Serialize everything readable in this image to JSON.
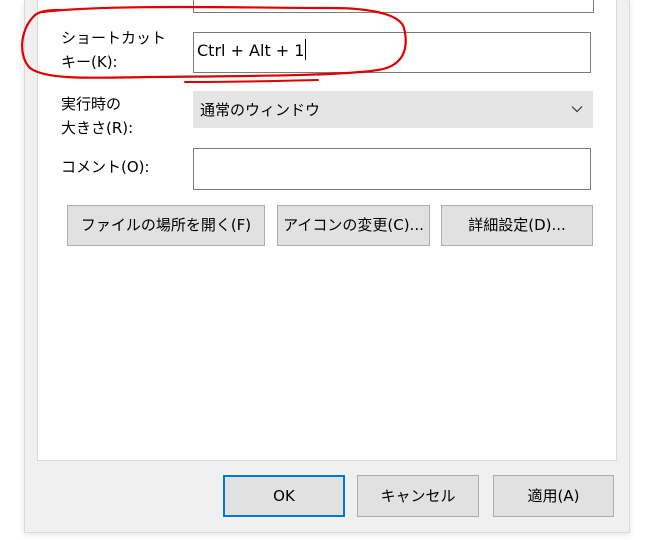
{
  "fields": {
    "shortcut_label": "ショートカット\nキー(K):",
    "shortcut_value": "Ctrl + Alt + 1",
    "run_label": "実行時の\n大きさ(R):",
    "run_value": "通常のウィンドウ",
    "comment_label": "コメント(O):",
    "comment_value": ""
  },
  "buttons": {
    "open_location": "ファイルの場所を開く(F)",
    "change_icon": "アイコンの変更(C)...",
    "advanced": "詳細設定(D)..."
  },
  "dialog_buttons": {
    "ok": "OK",
    "cancel": "キャンセル",
    "apply": "適用(A)"
  },
  "colors": {
    "dialog_bg": "#f0f0f0",
    "panel_bg": "#ffffff",
    "button_bg": "#e1e1e1",
    "default_button_border": "#0078d7",
    "annotation": "#e00000"
  },
  "icons": {
    "dropdown": "chevron-down-icon"
  }
}
